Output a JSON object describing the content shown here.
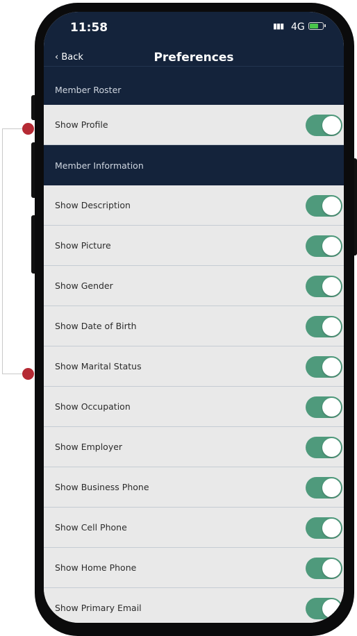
{
  "status_bar": {
    "time": "11:58",
    "network": "4G",
    "signal_icon": "signal-icon",
    "battery_icon": "battery-charging-icon"
  },
  "nav": {
    "back_label": "Back",
    "title": "Preferences"
  },
  "sections": [
    {
      "label": "Member Roster",
      "rows": [
        {
          "label": "Show Profile",
          "on": true
        }
      ]
    },
    {
      "label": "Member Information",
      "rows": [
        {
          "label": "Show Description",
          "on": true
        },
        {
          "label": "Show Picture",
          "on": true
        },
        {
          "label": "Show Gender",
          "on": true
        },
        {
          "label": "Show Date of Birth",
          "on": true
        },
        {
          "label": "Show Marital Status",
          "on": true
        },
        {
          "label": "Show Occupation",
          "on": true
        },
        {
          "label": "Show Employer",
          "on": true
        },
        {
          "label": "Show Business Phone",
          "on": true
        },
        {
          "label": "Show Cell Phone",
          "on": true
        },
        {
          "label": "Show Home Phone",
          "on": true
        },
        {
          "label": "Show Primary Email",
          "on": true
        }
      ]
    }
  ],
  "colors": {
    "header": "#14233b",
    "toggle_on": "#4f9a7c",
    "annotation_dot": "#b52a34"
  }
}
